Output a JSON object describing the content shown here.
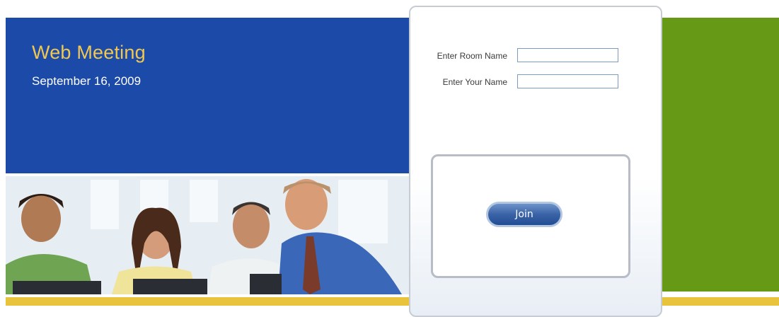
{
  "header": {
    "title": "Web Meeting",
    "date": "September 16, 2009"
  },
  "login_form": {
    "room_name_label": "Enter Room Name",
    "room_name_value": "",
    "your_name_label": "Enter Your Name",
    "your_name_value": "",
    "join_label": "Join"
  },
  "colors": {
    "header_blue": "#1c4aa8",
    "title_gold": "#f0c850",
    "side_green": "#669a16",
    "footer_yellow": "#e8c43c",
    "button_blue": "#2f5a9e"
  }
}
